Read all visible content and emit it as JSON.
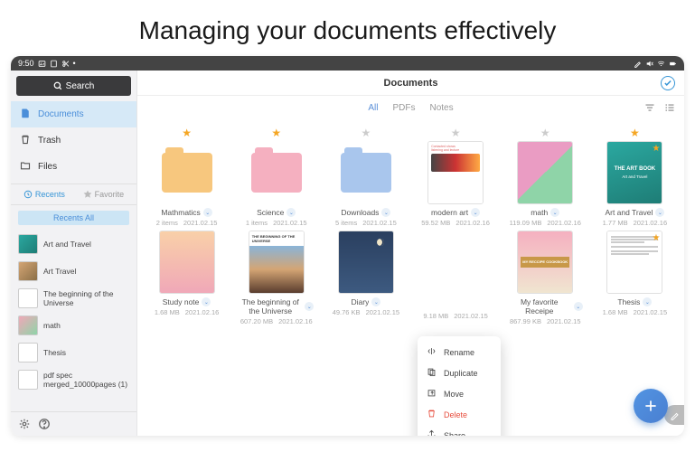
{
  "hero": {
    "title": "Managing your documents effectively"
  },
  "statusbar": {
    "time": "9:50"
  },
  "sidebar": {
    "search_label": "Search",
    "nav": [
      {
        "label": "Documents",
        "icon": "doc",
        "active": true
      },
      {
        "label": "Trash",
        "icon": "trash",
        "active": false
      },
      {
        "label": "Files",
        "icon": "folder",
        "active": false
      }
    ],
    "tags": {
      "recents": "Recents",
      "favorite": "Favorite"
    },
    "recents_all": "Recents All",
    "recent_items": [
      {
        "label": "Art and Travel",
        "thumb": "teal"
      },
      {
        "label": "Art Travel",
        "thumb": "photo"
      },
      {
        "label": "The beginning of the Universe",
        "thumb": "doc"
      },
      {
        "label": "math",
        "thumb": "pink"
      },
      {
        "label": "Thesis",
        "thumb": "doc"
      },
      {
        "label": "pdf spec merged_10000pages (1)",
        "thumb": "doc"
      }
    ]
  },
  "main": {
    "title": "Documents",
    "tabs": [
      {
        "label": "All",
        "active": true
      },
      {
        "label": "PDFs",
        "active": false
      },
      {
        "label": "Notes",
        "active": false
      }
    ]
  },
  "context_menu": [
    {
      "label": "Rename",
      "icon": "rename"
    },
    {
      "label": "Duplicate",
      "icon": "duplicate"
    },
    {
      "label": "Move",
      "icon": "move"
    },
    {
      "label": "Delete",
      "icon": "delete",
      "danger": true
    },
    {
      "label": "Share",
      "icon": "share"
    }
  ],
  "items": [
    {
      "name": "Mathmatics",
      "starred": true,
      "type": "folder",
      "color": "#f7c77e",
      "meta1": "2 items",
      "meta2": "2021.02.15"
    },
    {
      "name": "Science",
      "starred": true,
      "type": "folder",
      "color": "#f5b0c0",
      "meta1": "1 items",
      "meta2": "2021.02.15"
    },
    {
      "name": "Downloads",
      "starred": false,
      "type": "folder",
      "color": "#a9c6ed",
      "meta1": "5 items",
      "meta2": "2021.02.15"
    },
    {
      "name": "modern art",
      "starred": false,
      "type": "doc",
      "thumb": "modernart",
      "meta1": "59.52 MB",
      "meta2": "2021.02.16"
    },
    {
      "name": "math",
      "starred": false,
      "type": "doc",
      "thumb": "pinkgreen",
      "meta1": "119.09 MB",
      "meta2": "2021.02.16"
    },
    {
      "name": "Art and Travel",
      "starred": true,
      "type": "doc",
      "thumb": "artbook",
      "title_text": "THE ART BOOK",
      "sub_text": "Art and Travel",
      "meta1": "1.77 MB",
      "meta2": "2021.02.16"
    },
    {
      "name": "Study note",
      "starred": false,
      "type": "doc",
      "thumb": "gradient",
      "meta1": "1.68 MB",
      "meta2": "2021.02.16"
    },
    {
      "name": "The beginning of the Universe",
      "starred": false,
      "type": "doc",
      "thumb": "universe",
      "title_text": "THE BEGINNING OF THE UNIVERSE",
      "meta1": "607.20 MB",
      "meta2": "2021.02.16"
    },
    {
      "name": "Diary",
      "starred": false,
      "type": "doc",
      "thumb": "night",
      "meta1": "49.76 KB",
      "meta2": "2021.02.15"
    },
    {
      "name": "",
      "starred": false,
      "type": "hidden",
      "meta1": "9.18 MB",
      "meta2": "2021.02.15"
    },
    {
      "name": "My favorite Receipe",
      "starred": false,
      "type": "doc",
      "thumb": "recipe",
      "title_text": "MY RECCIPE COOKBOOK",
      "meta1": "867.99 KB",
      "meta2": "2021.02.15"
    },
    {
      "name": "Thesis",
      "starred": true,
      "type": "doc",
      "thumb": "thesis",
      "meta1": "1.68 MB",
      "meta2": "2021.02.15"
    }
  ]
}
